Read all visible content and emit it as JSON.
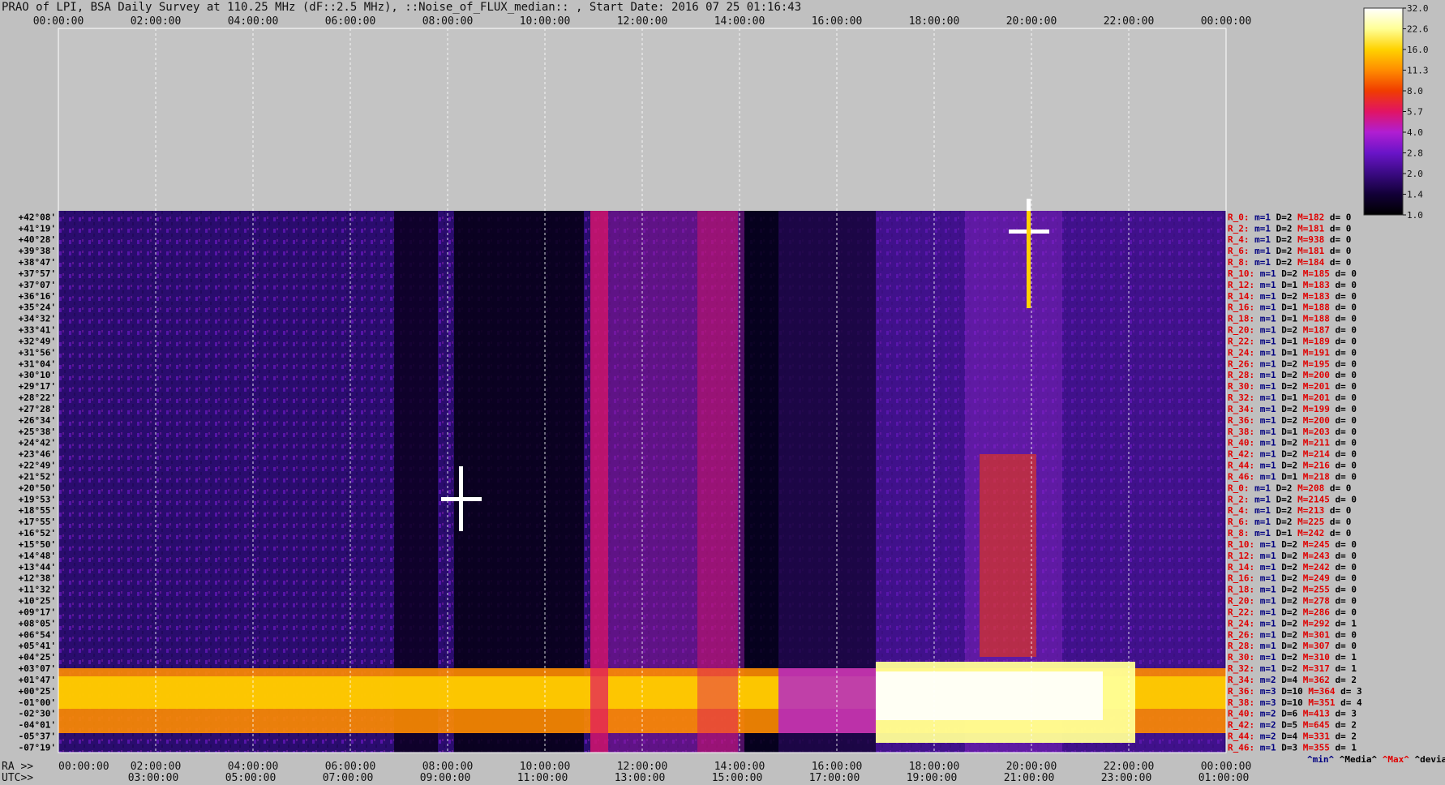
{
  "title": "PRAO of LPI, BSA Daily Survey at 110.25 MHz (dF::2.5 MHz), ::Noise_of_FLUX_median:: , Start Date: 2016 07 25 01:16:43",
  "colors": {
    "background": "#c0c0c0",
    "colormap": [
      "#000000",
      "#120037",
      "#3a0a82",
      "#6a14c8",
      "#b01ed2",
      "#e11464",
      "#f03c00",
      "#ff8c00",
      "#ffd200",
      "#ffff96",
      "#ffffff"
    ],
    "row_label_dec": "#000000",
    "row_label_r": "#e00000",
    "row_label_m": "#000080",
    "row_label_max": "#e00000"
  },
  "chart_data": {
    "type": "heatmap",
    "title": "PRAO of LPI, BSA Daily Survey at 110.25 MHz (dF::2.5 MHz), ::Noise_of_FLUX_median:: , Start Date: 2016 07 25 01:16:43",
    "x_top_ticks": [
      "00:00:00",
      "02:00:00",
      "04:00:00",
      "06:00:00",
      "08:00:00",
      "10:00:00",
      "12:00:00",
      "14:00:00",
      "16:00:00",
      "18:00:00",
      "20:00:00",
      "22:00:00",
      "00:00:00"
    ],
    "x_bottom_ra_prefix": "RA >>",
    "x_bottom_ra_ticks": [
      "00:00:00",
      "02:00:00",
      "04:00:00",
      "06:00:00",
      "08:00:00",
      "10:00:00",
      "12:00:00",
      "14:00:00",
      "16:00:00",
      "18:00:00",
      "20:00:00",
      "22:00:00",
      "00:00:00"
    ],
    "x_bottom_utc_prefix": "UTC>>",
    "x_bottom_utc_ticks": [
      "03:00:00",
      "05:00:00",
      "07:00:00",
      "09:00:00",
      "11:00:00",
      "13:00:00",
      "15:00:00",
      "17:00:00",
      "19:00:00",
      "21:00:00",
      "23:00:00",
      "01:00:00"
    ],
    "colorbar": {
      "ticks": [
        "32.0",
        "22.6",
        "16.0",
        "11.3",
        "8.0",
        "5.7",
        "4.0",
        "2.8",
        "2.0",
        "1.4",
        "1.0"
      ],
      "range": [
        1.0,
        32.0
      ],
      "scale": "log2"
    },
    "rows": [
      {
        "dec": "+42°08'",
        "r": "R_0:",
        "m": "m=1",
        "d": "D=2",
        "max": "M=182",
        "dev": "d= 0"
      },
      {
        "dec": "+41°19'",
        "r": "R_2:",
        "m": "m=1",
        "d": "D=2",
        "max": "M=181",
        "dev": "d= 0"
      },
      {
        "dec": "+40°28'",
        "r": "R_4:",
        "m": "m=1",
        "d": "D=2",
        "max": "M=938",
        "dev": "d= 0"
      },
      {
        "dec": "+39°38'",
        "r": "R_6:",
        "m": "m=1",
        "d": "D=2",
        "max": "M=181",
        "dev": "d= 0"
      },
      {
        "dec": "+38°47'",
        "r": "R_8:",
        "m": "m=1",
        "d": "D=2",
        "max": "M=184",
        "dev": "d= 0"
      },
      {
        "dec": "+37°57'",
        "r": "R_10:",
        "m": "m=1",
        "d": "D=2",
        "max": "M=185",
        "dev": "d= 0"
      },
      {
        "dec": "+37°07'",
        "r": "R_12:",
        "m": "m=1",
        "d": "D=1",
        "max": "M=183",
        "dev": "d= 0"
      },
      {
        "dec": "+36°16'",
        "r": "R_14:",
        "m": "m=1",
        "d": "D=2",
        "max": "M=183",
        "dev": "d= 0"
      },
      {
        "dec": "+35°24'",
        "r": "R_16:",
        "m": "m=1",
        "d": "D=1",
        "max": "M=188",
        "dev": "d= 0"
      },
      {
        "dec": "+34°32'",
        "r": "R_18:",
        "m": "m=1",
        "d": "D=1",
        "max": "M=188",
        "dev": "d= 0"
      },
      {
        "dec": "+33°41'",
        "r": "R_20:",
        "m": "m=1",
        "d": "D=2",
        "max": "M=187",
        "dev": "d= 0"
      },
      {
        "dec": "+32°49'",
        "r": "R_22:",
        "m": "m=1",
        "d": "D=1",
        "max": "M=189",
        "dev": "d= 0"
      },
      {
        "dec": "+31°56'",
        "r": "R_24:",
        "m": "m=1",
        "d": "D=1",
        "max": "M=191",
        "dev": "d= 0"
      },
      {
        "dec": "+31°04'",
        "r": "R_26:",
        "m": "m=1",
        "d": "D=2",
        "max": "M=195",
        "dev": "d= 0"
      },
      {
        "dec": "+30°10'",
        "r": "R_28:",
        "m": "m=1",
        "d": "D=2",
        "max": "M=200",
        "dev": "d= 0"
      },
      {
        "dec": "+29°17'",
        "r": "R_30:",
        "m": "m=1",
        "d": "D=2",
        "max": "M=201",
        "dev": "d= 0"
      },
      {
        "dec": "+28°22'",
        "r": "R_32:",
        "m": "m=1",
        "d": "D=1",
        "max": "M=201",
        "dev": "d= 0"
      },
      {
        "dec": "+27°28'",
        "r": "R_34:",
        "m": "m=1",
        "d": "D=2",
        "max": "M=199",
        "dev": "d= 0"
      },
      {
        "dec": "+26°34'",
        "r": "R_36:",
        "m": "m=1",
        "d": "D=2",
        "max": "M=200",
        "dev": "d= 0"
      },
      {
        "dec": "+25°38'",
        "r": "R_38:",
        "m": "m=1",
        "d": "D=1",
        "max": "M=203",
        "dev": "d= 0"
      },
      {
        "dec": "+24°42'",
        "r": "R_40:",
        "m": "m=1",
        "d": "D=2",
        "max": "M=211",
        "dev": "d= 0"
      },
      {
        "dec": "+23°46'",
        "r": "R_42:",
        "m": "m=1",
        "d": "D=2",
        "max": "M=214",
        "dev": "d= 0"
      },
      {
        "dec": "+22°49'",
        "r": "R_44:",
        "m": "m=1",
        "d": "D=2",
        "max": "M=216",
        "dev": "d= 0"
      },
      {
        "dec": "+21°52'",
        "r": "R_46:",
        "m": "m=1",
        "d": "D=1",
        "max": "M=218",
        "dev": "d= 0"
      },
      {
        "dec": "+20°50'",
        "r": "R_0:",
        "m": "m=1",
        "d": "D=2",
        "max": "M=208",
        "dev": "d= 0"
      },
      {
        "dec": "+19°53'",
        "r": "R_2:",
        "m": "m=1",
        "d": "D=2",
        "max": "M=2145",
        "dev": "d= 0"
      },
      {
        "dec": "+18°55'",
        "r": "R_4:",
        "m": "m=1",
        "d": "D=2",
        "max": "M=213",
        "dev": "d= 0"
      },
      {
        "dec": "+17°55'",
        "r": "R_6:",
        "m": "m=1",
        "d": "D=2",
        "max": "M=225",
        "dev": "d= 0"
      },
      {
        "dec": "+16°52'",
        "r": "R_8:",
        "m": "m=1",
        "d": "D=1",
        "max": "M=242",
        "dev": "d= 0"
      },
      {
        "dec": "+15°50'",
        "r": "R_10:",
        "m": "m=1",
        "d": "D=2",
        "max": "M=245",
        "dev": "d= 0"
      },
      {
        "dec": "+14°48'",
        "r": "R_12:",
        "m": "m=1",
        "d": "D=2",
        "max": "M=243",
        "dev": "d= 0"
      },
      {
        "dec": "+13°44'",
        "r": "R_14:",
        "m": "m=1",
        "d": "D=2",
        "max": "M=242",
        "dev": "d= 0"
      },
      {
        "dec": "+12°38'",
        "r": "R_16:",
        "m": "m=1",
        "d": "D=2",
        "max": "M=249",
        "dev": "d= 0"
      },
      {
        "dec": "+11°32'",
        "r": "R_18:",
        "m": "m=1",
        "d": "D=2",
        "max": "M=255",
        "dev": "d= 0"
      },
      {
        "dec": "+10°25'",
        "r": "R_20:",
        "m": "m=1",
        "d": "D=2",
        "max": "M=278",
        "dev": "d= 0"
      },
      {
        "dec": "+09°17'",
        "r": "R_22:",
        "m": "m=1",
        "d": "D=2",
        "max": "M=286",
        "dev": "d= 0"
      },
      {
        "dec": "+08°05'",
        "r": "R_24:",
        "m": "m=1",
        "d": "D=2",
        "max": "M=292",
        "dev": "d= 1"
      },
      {
        "dec": "+06°54'",
        "r": "R_26:",
        "m": "m=1",
        "d": "D=2",
        "max": "M=301",
        "dev": "d= 0"
      },
      {
        "dec": "+05°41'",
        "r": "R_28:",
        "m": "m=1",
        "d": "D=2",
        "max": "M=307",
        "dev": "d= 0"
      },
      {
        "dec": "+04°25'",
        "r": "R_30:",
        "m": "m=1",
        "d": "D=2",
        "max": "M=310",
        "dev": "d= 1"
      },
      {
        "dec": "+03°07'",
        "r": "R_32:",
        "m": "m=1",
        "d": "D=2",
        "max": "M=317",
        "dev": "d= 1"
      },
      {
        "dec": "+01°47'",
        "r": "R_34:",
        "m": "m=2",
        "d": "D=4",
        "max": "M=362",
        "dev": "d= 2"
      },
      {
        "dec": "+00°25'",
        "r": "R_36:",
        "m": "m=3",
        "d": "D=10",
        "max": "M=364",
        "dev": "d= 3"
      },
      {
        "dec": "-01°00'",
        "r": "R_38:",
        "m": "m=3",
        "d": "D=10",
        "max": "M=351",
        "dev": "d= 4"
      },
      {
        "dec": "-02°30'",
        "r": "R_40:",
        "m": "m=2",
        "d": "D=6",
        "max": "M=413",
        "dev": "d= 3"
      },
      {
        "dec": "-04°01'",
        "r": "R_42:",
        "m": "m=2",
        "d": "D=5",
        "max": "M=645",
        "dev": "d= 2"
      },
      {
        "dec": "-05°37'",
        "r": "R_44:",
        "m": "m=2",
        "d": "D=4",
        "max": "M=331",
        "dev": "d= 2"
      },
      {
        "dec": "-07°19'",
        "r": "R_46:",
        "m": "m=1",
        "d": "D=3",
        "max": "M=355",
        "dev": "d= 1"
      }
    ],
    "legend_footer": {
      "min": "^min^",
      "media": "^Media^",
      "max": "^Max^",
      "devia": "^devia^"
    }
  }
}
